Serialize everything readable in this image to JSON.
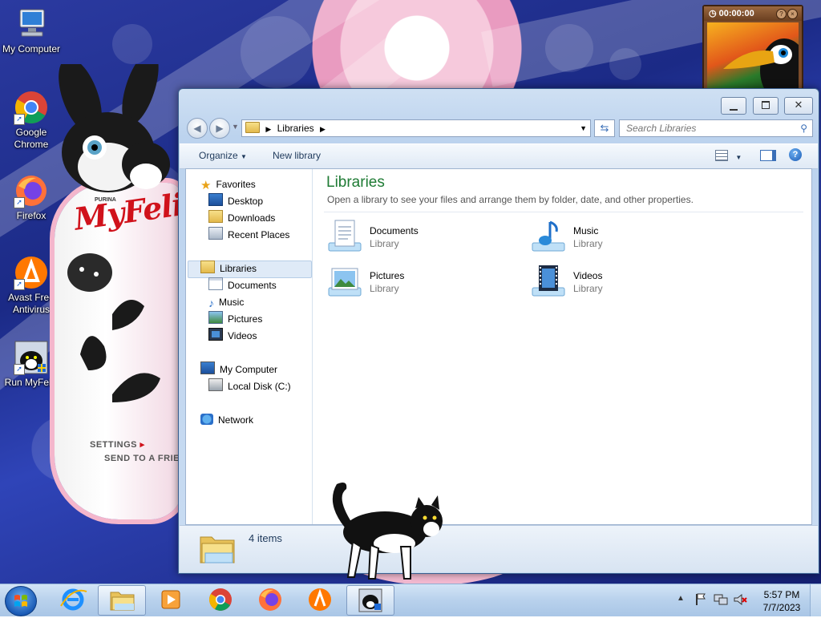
{
  "desktop": {
    "icons": [
      {
        "label": "My Computer",
        "icon": "computer-icon"
      },
      {
        "label": "Google Chrome",
        "icon": "chrome-icon"
      },
      {
        "label": "Firefox",
        "icon": "firefox-icon"
      },
      {
        "label": "Avast Free Antivirus",
        "icon": "avast-icon"
      },
      {
        "label": "Run MyFelix",
        "icon": "myfelix-icon"
      }
    ]
  },
  "gadgets": {
    "felix": {
      "brand": "MyFelix",
      "maker": "PURINA",
      "settings": "SETTINGS",
      "send": "SEND TO A FRIEND"
    },
    "timer": {
      "time": "00:00:00"
    }
  },
  "window": {
    "breadcrumb": "Libraries",
    "search_placeholder": "Search Libraries",
    "toolbar": {
      "organize": "Organize",
      "new_library": "New library"
    },
    "nav": {
      "favorites": "Favorites",
      "desktop": "Desktop",
      "downloads": "Downloads",
      "recent": "Recent Places",
      "libraries": "Libraries",
      "documents": "Documents",
      "music": "Music",
      "pictures": "Pictures",
      "videos": "Videos",
      "computer": "My Computer",
      "localdisk": "Local Disk (C:)",
      "network": "Network"
    },
    "main": {
      "title": "Libraries",
      "subtitle": "Open a library to see your files and arrange them by folder, date, and other properties.",
      "libraries": [
        {
          "name": "Documents",
          "type": "Library"
        },
        {
          "name": "Music",
          "type": "Library"
        },
        {
          "name": "Pictures",
          "type": "Library"
        },
        {
          "name": "Videos",
          "type": "Library"
        }
      ]
    },
    "status": {
      "items": "4 items"
    }
  },
  "taskbar": {
    "apps": [
      "internet-explorer-icon",
      "explorer-icon",
      "media-player-icon",
      "chrome-icon",
      "firefox-icon",
      "avast-icon",
      "myfelix-icon"
    ],
    "time": "5:57 PM",
    "date": "7/7/2023"
  }
}
